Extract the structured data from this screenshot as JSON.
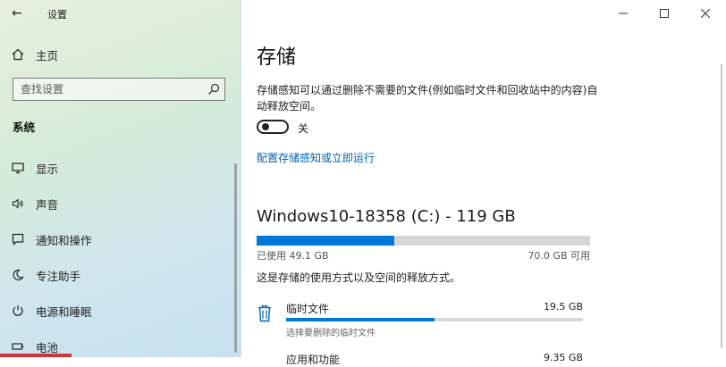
{
  "window": {
    "title": "设置",
    "back_icon": "back-arrow-icon",
    "controls": [
      "minimize-icon",
      "maximize-icon",
      "close-icon"
    ]
  },
  "sidebar": {
    "home_label": "主页",
    "search_placeholder": "查找设置",
    "section_label": "系统",
    "items": [
      {
        "label": "显示",
        "icon": "monitor-icon"
      },
      {
        "label": "声音",
        "icon": "speaker-icon"
      },
      {
        "label": "通知和操作",
        "icon": "notification-icon"
      },
      {
        "label": "专注助手",
        "icon": "moon-icon"
      },
      {
        "label": "电源和睡眠",
        "icon": "power-icon"
      },
      {
        "label": "电池",
        "icon": "battery-icon"
      }
    ]
  },
  "main": {
    "title": "存储",
    "storage_sense_description": "存储感知可以通过删除不需要的文件(例如临时文件和回收站中的内容)自动释放空间。",
    "toggle_state": "关",
    "configure_link": "配置存储感知或立即运行",
    "drive": {
      "title": "Windows10-18358 (C:) - 119 GB",
      "used_label": "已使用 49.1 GB",
      "available_label": "70.0 GB 可用",
      "used_fraction": 0.412
    },
    "usage_description": "这是存储的使用方式以及空间的释放方式。",
    "categories": [
      {
        "name": "临时文件",
        "size": "19.5 GB",
        "sub": "选择要删除的临时文件",
        "fraction": 0.5,
        "icon": "trash-icon"
      },
      {
        "name": "应用和功能",
        "size": "9.35 GB"
      }
    ]
  },
  "colors": {
    "accent": "#0078d7",
    "link": "#0063b1"
  }
}
